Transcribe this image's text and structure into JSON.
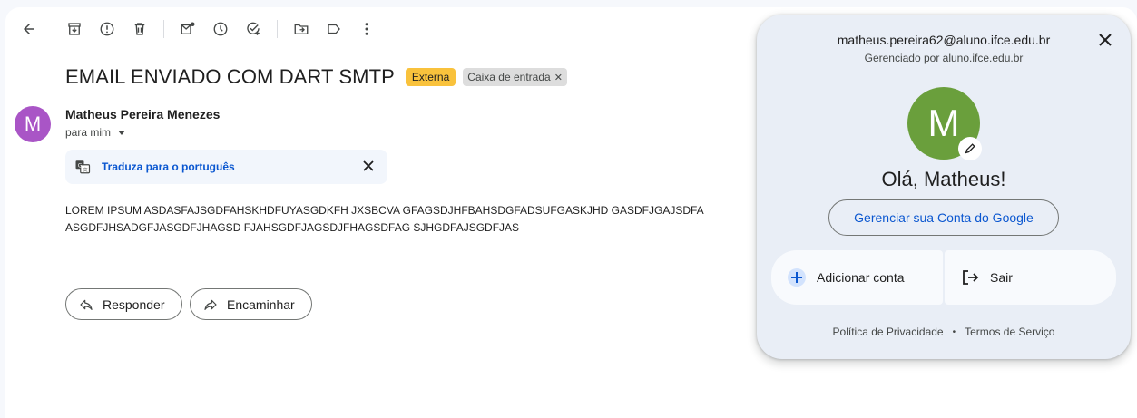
{
  "toolbar": {
    "icons": [
      "back-arrow-icon",
      "archive-icon",
      "report-spam-icon",
      "delete-icon",
      "mark-unread-icon",
      "snooze-icon",
      "add-task-icon",
      "move-to-icon",
      "label-icon",
      "more-vert-icon"
    ]
  },
  "email": {
    "subject": "EMAIL ENVIADO COM DART SMTP",
    "badge_external": "Externa",
    "badge_inbox": "Caixa de entrada",
    "sender_initial": "M",
    "sender_name": "Matheus Pereira Menezes",
    "recipient": "para mim",
    "translate_label": "Traduza para o português",
    "body_line1": "LOREM IPSUM ASDASFAJSGDFAHSKHDFUYASGDKFH JXSBCVA GFAGSDJHFBAHSDGFADSUFGASKJHD GASDFJGAJSDFA",
    "body_line2": "ASGDFJHSADGFJASGDFJHAGSD FJAHSGDFJAGSDJFHAGSDFAG SJHGDFAJSGDFJAS",
    "reply_label": "Responder",
    "forward_label": "Encaminhar"
  },
  "account_panel": {
    "email": "matheus.pereira62@aluno.ifce.edu.br",
    "managed_by": "Gerenciado por aluno.ifce.edu.br",
    "avatar_initial": "M",
    "greeting": "Olá, Matheus!",
    "manage_button": "Gerenciar sua Conta do Google",
    "add_account": "Adicionar conta",
    "sign_out": "Sair",
    "privacy": "Política de Privacidade",
    "footer_separator": "•",
    "terms": "Termos de Serviço"
  },
  "colors": {
    "accent_blue": "#0b57d0",
    "badge_yellow": "#f9c23c",
    "sender_avatar": "#a955c6",
    "account_avatar": "#6a9f3c",
    "panel_bg": "#e9eef6"
  }
}
